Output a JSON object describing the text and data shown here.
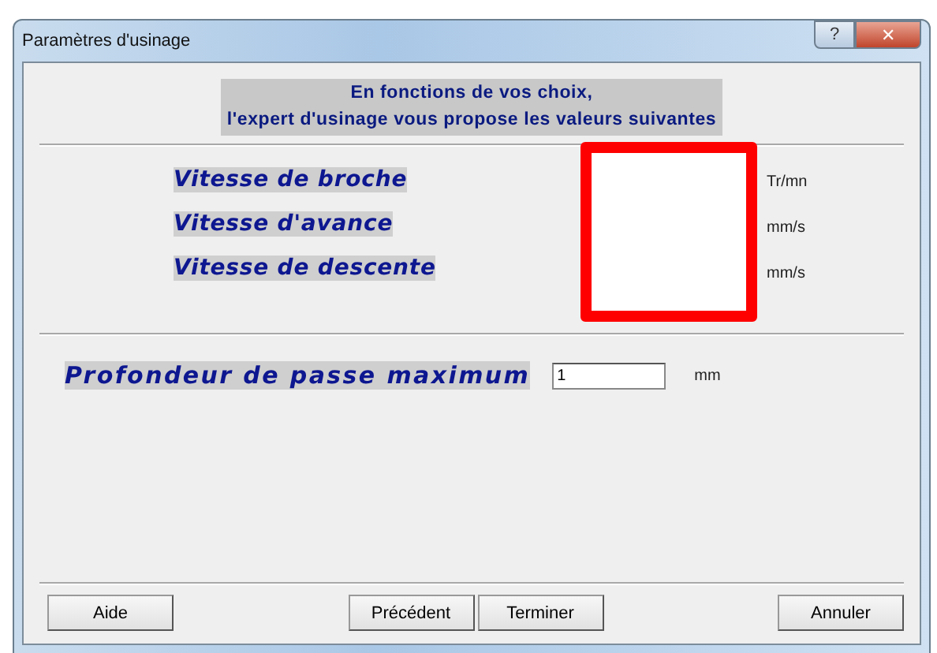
{
  "window": {
    "title": "Paramètres d'usinage",
    "buttons": [
      "?",
      "✕"
    ]
  },
  "header": [
    "En fonctions de vos choix,",
    "l'expert d'usinage vous propose les valeurs suivantes"
  ],
  "speeds": [
    {
      "label": "Vitesse de broche",
      "unit": "Tr/mn"
    },
    {
      "label": "Vitesse d'avance",
      "unit": "mm/s"
    },
    {
      "label": "Vitesse de descente",
      "unit": "mm/s"
    }
  ],
  "depth": {
    "label": "Profondeur de passe maximum",
    "value": "1",
    "unit": "mm"
  },
  "buttons": {
    "left": [
      "Aide"
    ],
    "center": [
      "Précédent",
      "Terminer"
    ],
    "right": [
      "Annuler"
    ]
  }
}
